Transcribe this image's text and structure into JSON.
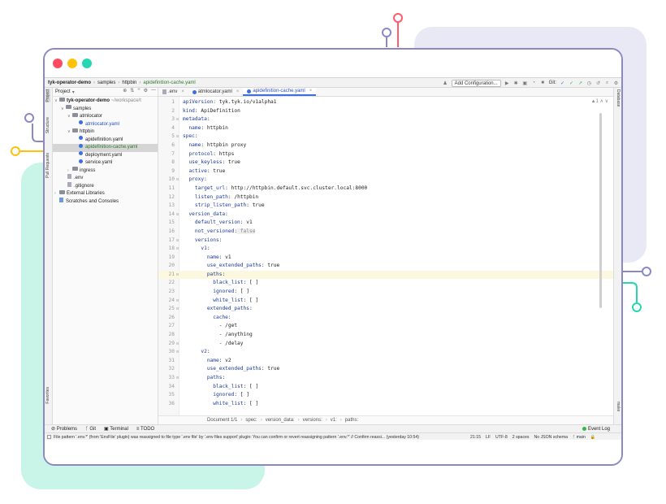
{
  "colors": {
    "accent": "#3d6fe0",
    "window_border": "#8c88c6",
    "traffic_red": "#ff4a62",
    "traffic_yellow": "#ffc20a",
    "traffic_green": "#24d6b2",
    "deco_mint": "#c9f5e8",
    "deco_lavender": "#e9e9f6"
  },
  "navbar": {
    "crumbs": [
      "tyk-operator-demo",
      "samples",
      "httpbin",
      "apidefinition-cache.yaml"
    ],
    "add_config": "Add Configuration...",
    "git_label": "Git:"
  },
  "left_stripe": {
    "project": "Project",
    "structure": "Structure",
    "pull_requests": "Pull Requests",
    "favorites": "Favorites"
  },
  "right_stripe": {
    "database": "Database",
    "make": "make"
  },
  "project_panel": {
    "title": "Project",
    "tree": [
      {
        "label": "tyk-operator-demo",
        "suffix": "~/workspace/t",
        "type": "root"
      },
      {
        "label": "samples",
        "type": "folder"
      },
      {
        "label": "atmlocator",
        "type": "folder"
      },
      {
        "label": "atmlocator.yaml",
        "type": "yaml"
      },
      {
        "label": "httpbin",
        "type": "folder"
      },
      {
        "label": "apidefinition.yaml",
        "type": "yaml"
      },
      {
        "label": "apidefinition-cache.yaml",
        "type": "yaml"
      },
      {
        "label": "deployment.yaml",
        "type": "yaml"
      },
      {
        "label": "service.yaml",
        "type": "yaml"
      },
      {
        "label": "ingress",
        "type": "folder"
      },
      {
        "label": ".env",
        "type": "file"
      },
      {
        "label": ".gitignore",
        "type": "file"
      },
      {
        "label": "External Libraries",
        "type": "lib"
      },
      {
        "label": "Scratches and Consoles",
        "type": "scratch"
      }
    ]
  },
  "tabs": [
    {
      "label": ".env"
    },
    {
      "label": "atmlocator.yaml"
    },
    {
      "label": "apidefinition-cache.yaml"
    }
  ],
  "inspection": "▲1",
  "code_lines": [
    {
      "n": "1",
      "key": "apiVersion",
      "val": " tyk.tyk.io/v1alpha1",
      "indent": ""
    },
    {
      "n": "2",
      "key": "kind",
      "val": " ApiDefinition",
      "indent": ""
    },
    {
      "n": "3",
      "key": "metadata",
      "val": "",
      "indent": ""
    },
    {
      "n": "4",
      "key": "name",
      "val": " httpbin",
      "indent": "  "
    },
    {
      "n": "5",
      "key": "spec",
      "val": "",
      "indent": ""
    },
    {
      "n": "6",
      "key": "name",
      "val": " httpbin proxy",
      "indent": "  "
    },
    {
      "n": "7",
      "key": "protocol",
      "val": " https",
      "indent": "  "
    },
    {
      "n": "8",
      "key": "use_keyless",
      "val": " true",
      "indent": "  "
    },
    {
      "n": "9",
      "key": "active",
      "val": " true",
      "indent": "  "
    },
    {
      "n": "10",
      "key": "proxy",
      "val": "",
      "indent": "  "
    },
    {
      "n": "11",
      "key": "target_url",
      "val": " http://httpbin.default.svc.cluster.local:8000",
      "indent": "    "
    },
    {
      "n": "12",
      "key": "listen_path",
      "val": " /httpbin",
      "indent": "    "
    },
    {
      "n": "13",
      "key": "strip_listen_path",
      "val": " true",
      "indent": "    "
    },
    {
      "n": "14",
      "key": "version_data",
      "val": "",
      "indent": "  "
    },
    {
      "n": "15",
      "key": "default_version",
      "val": " v1",
      "indent": "    "
    },
    {
      "n": "16",
      "key": "not_versioned",
      "val": " false",
      "indent": "    "
    },
    {
      "n": "17",
      "key": "versions",
      "val": "",
      "indent": "    "
    },
    {
      "n": "18",
      "key": "v1",
      "val": "",
      "indent": "      "
    },
    {
      "n": "19",
      "key": "name",
      "val": " v1",
      "indent": "        "
    },
    {
      "n": "20",
      "key": "use_extended_paths",
      "val": " true",
      "indent": "        "
    },
    {
      "n": "21",
      "key": "paths",
      "val": "",
      "indent": "        "
    },
    {
      "n": "22",
      "key": "black_list",
      "val": " [ ]",
      "indent": "          "
    },
    {
      "n": "23",
      "key": "ignored",
      "val": " [ ]",
      "indent": "          "
    },
    {
      "n": "24",
      "key": "white_list",
      "val": " [ ]",
      "indent": "          "
    },
    {
      "n": "25",
      "key": "extended_paths",
      "val": "",
      "indent": "        "
    },
    {
      "n": "26",
      "key": "cache",
      "val": "",
      "indent": "          "
    },
    {
      "n": "27",
      "key": "",
      "val": "- /get",
      "indent": "            "
    },
    {
      "n": "28",
      "key": "",
      "val": "- /anything",
      "indent": "            "
    },
    {
      "n": "29",
      "key": "",
      "val": "- /delay",
      "indent": "            "
    },
    {
      "n": "30",
      "key": "v2",
      "val": "",
      "indent": "      "
    },
    {
      "n": "31",
      "key": "name",
      "val": " v2",
      "indent": "        "
    },
    {
      "n": "32",
      "key": "use_extended_paths",
      "val": " true",
      "indent": "        "
    },
    {
      "n": "33",
      "key": "paths",
      "val": "",
      "indent": "        "
    },
    {
      "n": "34",
      "key": "black_list",
      "val": " [ ]",
      "indent": "          "
    },
    {
      "n": "35",
      "key": "ignored",
      "val": " [ ]",
      "indent": "          "
    },
    {
      "n": "36",
      "key": "white_list",
      "val": " [ ]",
      "indent": "          "
    }
  ],
  "editor_crumbs": [
    "Document 1/1",
    "spec:",
    "version_data:",
    "versions:",
    "v1:",
    "paths:"
  ],
  "bottom_tools": [
    "Problems",
    "Git",
    "Terminal",
    "TODO"
  ],
  "event_log": "Event Log",
  "status": {
    "message": "File pattern '.env.*' (from 'EnvFile' plugin) was reassigned to file type '.env file' by '.env files support' plugin: You can confirm or revert reassigning pattern '.env.*' // Confirm reassi... (yesterday 10:54)",
    "position": "21:15",
    "line_sep": "LF",
    "encoding": "UTF-8",
    "indent": "2 spaces",
    "schema": "No JSON schema",
    "branch": "main"
  }
}
